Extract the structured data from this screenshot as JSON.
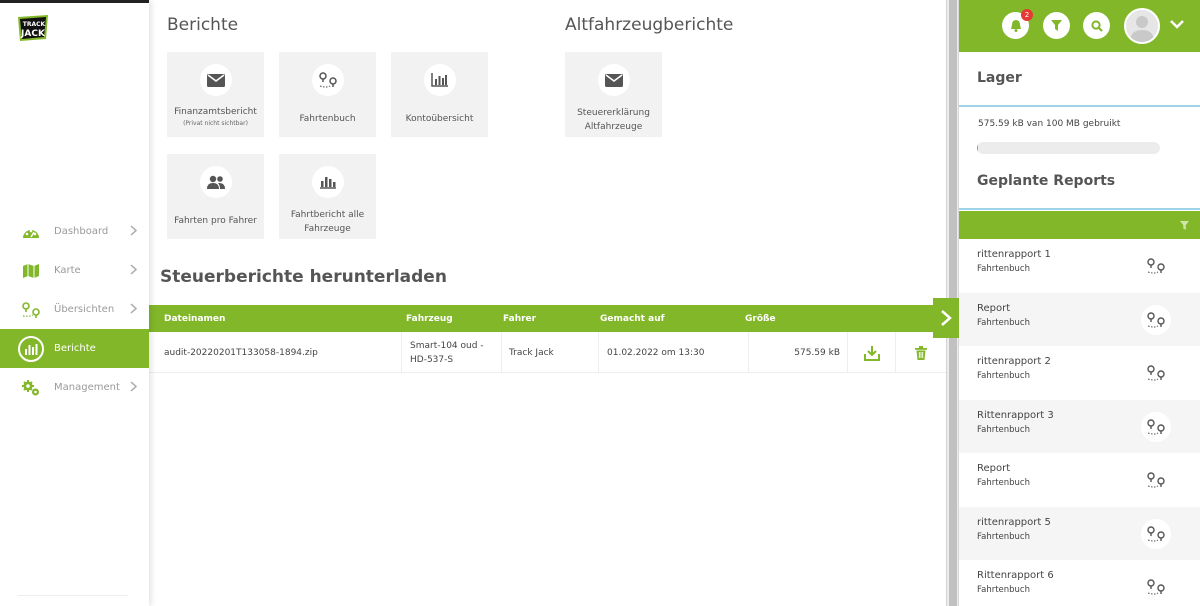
{
  "app": {
    "brand": "TRACK JACK",
    "accent": "#82b72a"
  },
  "sidebar": {
    "items": [
      {
        "label": "Dashboard",
        "icon": "dashboard-gauge-icon",
        "active": false
      },
      {
        "label": "Karte",
        "icon": "map-icon",
        "active": false
      },
      {
        "label": "Übersichten",
        "icon": "route-pins-icon",
        "active": false
      },
      {
        "label": "Berichte",
        "icon": "bar-chart-icon",
        "active": true
      },
      {
        "label": "Management",
        "icon": "gears-icon",
        "active": false
      }
    ]
  },
  "reports": {
    "title": "Berichte",
    "tiles": [
      {
        "label": "Finanzamtsbericht",
        "sub": "(Privat nicht sichtbar)",
        "icon": "envelope-icon"
      },
      {
        "label": "Fahrtenbuch",
        "icon": "route-pins-icon"
      },
      {
        "label": "Kontoübersicht",
        "icon": "bar-chart-icon"
      },
      {
        "label": "Fahrten pro Fahrer",
        "icon": "users-icon"
      },
      {
        "label": "Fahrtbericht alle Fahrzeuge",
        "icon": "bar-chart-icon"
      }
    ]
  },
  "old_reports": {
    "title": "Altfahrzeugberichte",
    "tiles": [
      {
        "label": "Steuererklärung Altfahrzeuge",
        "icon": "envelope-icon"
      }
    ]
  },
  "downloads": {
    "title": "Steuerberichte herunterladen",
    "headers": {
      "file": "Dateinamen",
      "vehicle": "Fahrzeug",
      "driver": "Fahrer",
      "made": "Gemacht auf",
      "size": "Größe"
    },
    "rows": [
      {
        "file": "audit-20220201T133058-1894.zip",
        "vehicle": "Smart-104 oud - HD-537-S",
        "driver": "Track Jack",
        "made": "01.02.2022 om 13:30",
        "size": "575.59 kB"
      }
    ]
  },
  "right_panel": {
    "notifications_count": "2",
    "storage": {
      "title": "Lager",
      "text": "575.59 kB van 100 MB gebruikt",
      "used_fraction": 0.0056
    },
    "scheduled": {
      "title": "Geplante Reports",
      "items": [
        {
          "name": "rittenrapport 1",
          "type": "Fahrtenbuch"
        },
        {
          "name": "Report",
          "type": "Fahrtenbuch"
        },
        {
          "name": "rittenrapport 2",
          "type": "Fahrtenbuch"
        },
        {
          "name": "Rittenrapport 3",
          "type": "Fahrtenbuch"
        },
        {
          "name": "Report",
          "type": "Fahrtenbuch"
        },
        {
          "name": "rittenrapport 5",
          "type": "Fahrtenbuch"
        },
        {
          "name": "Rittenrapport 6",
          "type": "Fahrtenbuch"
        }
      ]
    }
  }
}
